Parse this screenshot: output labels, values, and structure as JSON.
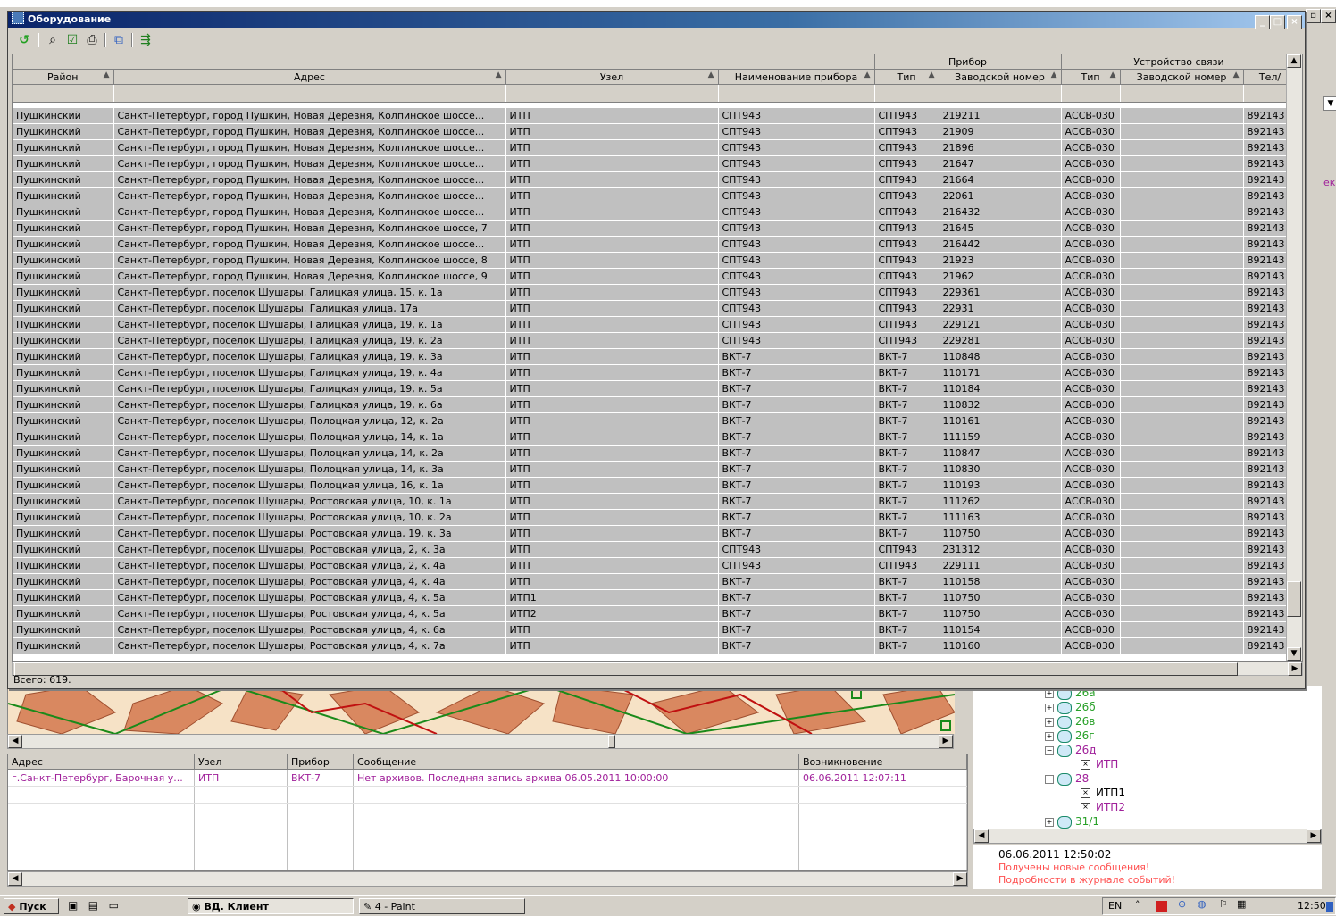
{
  "dialog": {
    "title": "Оборудование",
    "controls": [
      "_",
      "□",
      "×"
    ],
    "status": "Всего: 619."
  },
  "grid": {
    "group_headers": {
      "device": "Прибор",
      "comm": "Устройство связи"
    },
    "columns": [
      "Район",
      "Адрес",
      "Узел",
      "Наименование прибора",
      "Тип",
      "Заводской номер",
      "Тип",
      "Заводской номер",
      "Тел/"
    ],
    "rows": [
      [
        "Пушкинский",
        "Санкт-Петербург, город Пушкин, Новая Деревня, Колпинское шоссе...",
        "ИТП",
        "СПТ943",
        "СПТ943",
        "219211",
        "АССВ-030",
        "",
        "892143"
      ],
      [
        "Пушкинский",
        "Санкт-Петербург, город Пушкин, Новая Деревня, Колпинское шоссе...",
        "ИТП",
        "СПТ943",
        "СПТ943",
        "21909",
        "АССВ-030",
        "",
        "892143"
      ],
      [
        "Пушкинский",
        "Санкт-Петербург, город Пушкин, Новая Деревня, Колпинское шоссе...",
        "ИТП",
        "СПТ943",
        "СПТ943",
        "21896",
        "АССВ-030",
        "",
        "892143"
      ],
      [
        "Пушкинский",
        "Санкт-Петербург, город Пушкин, Новая Деревня, Колпинское шоссе...",
        "ИТП",
        "СПТ943",
        "СПТ943",
        "21647",
        "АССВ-030",
        "",
        "892143"
      ],
      [
        "Пушкинский",
        "Санкт-Петербург, город Пушкин, Новая Деревня, Колпинское шоссе...",
        "ИТП",
        "СПТ943",
        "СПТ943",
        "21664",
        "АССВ-030",
        "",
        "892143"
      ],
      [
        "Пушкинский",
        "Санкт-Петербург, город Пушкин, Новая Деревня, Колпинское шоссе...",
        "ИТП",
        "СПТ943",
        "СПТ943",
        "22061",
        "АССВ-030",
        "",
        "892143"
      ],
      [
        "Пушкинский",
        "Санкт-Петербург, город Пушкин, Новая Деревня, Колпинское шоссе...",
        "ИТП",
        "СПТ943",
        "СПТ943",
        "216432",
        "АССВ-030",
        "",
        "892143"
      ],
      [
        "Пушкинский",
        "Санкт-Петербург, город Пушкин, Новая Деревня, Колпинское шоссе, 7",
        "ИТП",
        "СПТ943",
        "СПТ943",
        "21645",
        "АССВ-030",
        "",
        "892143"
      ],
      [
        "Пушкинский",
        "Санкт-Петербург, город Пушкин, Новая Деревня, Колпинское шоссе...",
        "ИТП",
        "СПТ943",
        "СПТ943",
        "216442",
        "АССВ-030",
        "",
        "892143"
      ],
      [
        "Пушкинский",
        "Санкт-Петербург, город Пушкин, Новая Деревня, Колпинское шоссе, 8",
        "ИТП",
        "СПТ943",
        "СПТ943",
        "21923",
        "АССВ-030",
        "",
        "892143"
      ],
      [
        "Пушкинский",
        "Санкт-Петербург, город Пушкин, Новая Деревня, Колпинское шоссе, 9",
        "ИТП",
        "СПТ943",
        "СПТ943",
        "21962",
        "АССВ-030",
        "",
        "892143"
      ],
      [
        "Пушкинский",
        "Санкт-Петербург, поселок Шушары, Галицкая улица, 15, к. 1а",
        "ИТП",
        "СПТ943",
        "СПТ943",
        "229361",
        "АССВ-030",
        "",
        "892143"
      ],
      [
        "Пушкинский",
        "Санкт-Петербург, поселок Шушары, Галицкая улица, 17а",
        "ИТП",
        "СПТ943",
        "СПТ943",
        "22931",
        "АССВ-030",
        "",
        "892143"
      ],
      [
        "Пушкинский",
        "Санкт-Петербург, поселок Шушары, Галицкая улица, 19, к. 1а",
        "ИТП",
        "СПТ943",
        "СПТ943",
        "229121",
        "АССВ-030",
        "",
        "892143"
      ],
      [
        "Пушкинский",
        "Санкт-Петербург, поселок Шушары, Галицкая улица, 19, к. 2а",
        "ИТП",
        "СПТ943",
        "СПТ943",
        "229281",
        "АССВ-030",
        "",
        "892143"
      ],
      [
        "Пушкинский",
        "Санкт-Петербург, поселок Шушары, Галицкая улица, 19, к. 3а",
        "ИТП",
        "ВКТ-7",
        "ВКТ-7",
        "110848",
        "АССВ-030",
        "",
        "892143"
      ],
      [
        "Пушкинский",
        "Санкт-Петербург, поселок Шушары, Галицкая улица, 19, к. 4а",
        "ИТП",
        "ВКТ-7",
        "ВКТ-7",
        "110171",
        "АССВ-030",
        "",
        "892143"
      ],
      [
        "Пушкинский",
        "Санкт-Петербург, поселок Шушары, Галицкая улица, 19, к. 5а",
        "ИТП",
        "ВКТ-7",
        "ВКТ-7",
        "110184",
        "АССВ-030",
        "",
        "892143"
      ],
      [
        "Пушкинский",
        "Санкт-Петербург, поселок Шушары, Галицкая улица, 19, к. 6а",
        "ИТП",
        "ВКТ-7",
        "ВКТ-7",
        "110832",
        "АССВ-030",
        "",
        "892143"
      ],
      [
        "Пушкинский",
        "Санкт-Петербург, поселок Шушары, Полоцкая улица, 12, к. 2а",
        "ИТП",
        "ВКТ-7",
        "ВКТ-7",
        "110161",
        "АССВ-030",
        "",
        "892143"
      ],
      [
        "Пушкинский",
        "Санкт-Петербург, поселок Шушары, Полоцкая улица, 14, к. 1а",
        "ИТП",
        "ВКТ-7",
        "ВКТ-7",
        "111159",
        "АССВ-030",
        "",
        "892143"
      ],
      [
        "Пушкинский",
        "Санкт-Петербург, поселок Шушары, Полоцкая улица, 14, к. 2а",
        "ИТП",
        "ВКТ-7",
        "ВКТ-7",
        "110847",
        "АССВ-030",
        "",
        "892143"
      ],
      [
        "Пушкинский",
        "Санкт-Петербург, поселок Шушары, Полоцкая улица, 14, к. 3а",
        "ИТП",
        "ВКТ-7",
        "ВКТ-7",
        "110830",
        "АССВ-030",
        "",
        "892143"
      ],
      [
        "Пушкинский",
        "Санкт-Петербург, поселок Шушары, Полоцкая улица, 16, к. 1а",
        "ИТП",
        "ВКТ-7",
        "ВКТ-7",
        "110193",
        "АССВ-030",
        "",
        "892143"
      ],
      [
        "Пушкинский",
        "Санкт-Петербург, поселок Шушары, Ростовская улица, 10, к. 1а",
        "ИТП",
        "ВКТ-7",
        "ВКТ-7",
        "111262",
        "АССВ-030",
        "",
        "892143"
      ],
      [
        "Пушкинский",
        "Санкт-Петербург, поселок Шушары, Ростовская улица, 10, к. 2а",
        "ИТП",
        "ВКТ-7",
        "ВКТ-7",
        "111163",
        "АССВ-030",
        "",
        "892143"
      ],
      [
        "Пушкинский",
        "Санкт-Петербург, поселок Шушары, Ростовская улица, 19, к. 3а",
        "ИТП",
        "ВКТ-7",
        "ВКТ-7",
        "110750",
        "АССВ-030",
        "",
        "892143"
      ],
      [
        "Пушкинский",
        "Санкт-Петербург, поселок Шушары, Ростовская улица, 2, к. 3а",
        "ИТП",
        "СПТ943",
        "СПТ943",
        "231312",
        "АССВ-030",
        "",
        "892143"
      ],
      [
        "Пушкинский",
        "Санкт-Петербург, поселок Шушары, Ростовская улица, 2, к. 4а",
        "ИТП",
        "СПТ943",
        "СПТ943",
        "229111",
        "АССВ-030",
        "",
        "892143"
      ],
      [
        "Пушкинский",
        "Санкт-Петербург, поселок Шушары, Ростовская улица, 4, к. 4а",
        "ИТП",
        "ВКТ-7",
        "ВКТ-7",
        "110158",
        "АССВ-030",
        "",
        "892143"
      ],
      [
        "Пушкинский",
        "Санкт-Петербург, поселок Шушары, Ростовская улица, 4, к. 5а",
        "ИТП1",
        "ВКТ-7",
        "ВКТ-7",
        "110750",
        "АССВ-030",
        "",
        "892143"
      ],
      [
        "Пушкинский",
        "Санкт-Петербург, поселок Шушары, Ростовская улица, 4, к. 5а",
        "ИТП2",
        "ВКТ-7",
        "ВКТ-7",
        "110750",
        "АССВ-030",
        "",
        "892143"
      ],
      [
        "Пушкинский",
        "Санкт-Петербург, поселок Шушары, Ростовская улица, 4, к. 6а",
        "ИТП",
        "ВКТ-7",
        "ВКТ-7",
        "110154",
        "АССВ-030",
        "",
        "892143"
      ],
      [
        "Пушкинский",
        "Санкт-Петербург, поселок Шушары, Ростовская улица, 4, к. 7а",
        "ИТП",
        "ВКТ-7",
        "ВКТ-7",
        "110160",
        "АССВ-030",
        "",
        "892143"
      ]
    ]
  },
  "events": {
    "columns": [
      "Адрес",
      "Узел",
      "Прибор",
      "Сообщение",
      "Возникновение"
    ],
    "rows": [
      [
        "г.Санкт-Петербург, Барочная у...",
        "ИТП",
        "ВКТ-7",
        "Нет архивов. Последняя запись архива 06.05.2011 10:00:00",
        "06.06.2011 12:07:11"
      ]
    ]
  },
  "tree": {
    "items": [
      {
        "label": "26а",
        "kind": "node"
      },
      {
        "label": "26б",
        "kind": "node"
      },
      {
        "label": "26в",
        "kind": "node"
      },
      {
        "label": "26г",
        "kind": "node"
      },
      {
        "label": "26д",
        "kind": "node-open"
      },
      {
        "label": "ИТП",
        "kind": "leaf"
      },
      {
        "label": "28",
        "kind": "node-open"
      },
      {
        "label": "ИТП1",
        "kind": "leaf-black"
      },
      {
        "label": "ИТП2",
        "kind": "leaf"
      },
      {
        "label": "31/1",
        "kind": "node"
      }
    ]
  },
  "notice": {
    "time": "06.06.2011 12:50:02",
    "line1": "Получены новые сообщения!",
    "line2": "Подробности в журнале событий!"
  },
  "side_fragment": "ек",
  "taskbar": {
    "start": "Пуск",
    "tasks": [
      "ВД. Клиент",
      "4 - Paint"
    ],
    "lang": "EN",
    "clock": "12:50"
  },
  "colors": {
    "title_bar": "#0a246a",
    "event_text": "#a0209a",
    "notice_red": "#ff5050",
    "tree_green": "#28a028"
  }
}
